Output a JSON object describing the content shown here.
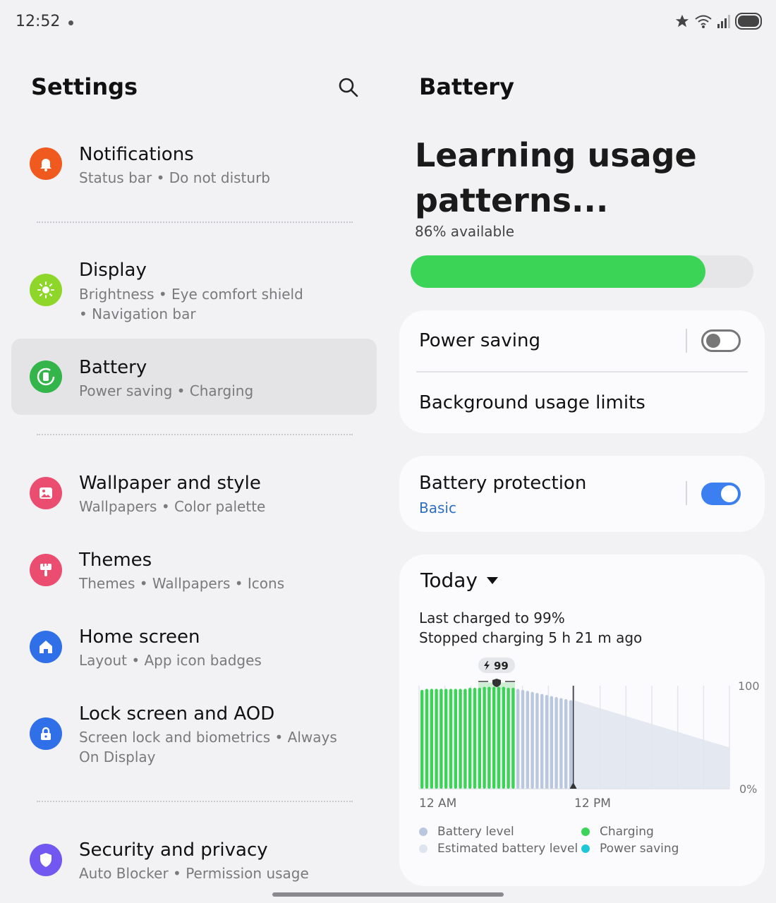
{
  "status_bar": {
    "time": "12:52",
    "icons": [
      "star-icon",
      "wifi-icon",
      "signal-icon",
      "battery-icon"
    ]
  },
  "left": {
    "title": "Settings",
    "items": [
      {
        "name": "notifications",
        "title": "Notifications",
        "subtitle": "Status bar  •  Do not disturb",
        "icon": "bell-icon",
        "color": "#f05a1f"
      },
      {
        "name": "display",
        "title": "Display",
        "subtitle": "Brightness  •  Eye comfort shield  •  Navigation bar",
        "icon": "sun-icon",
        "color": "#8fd62a"
      },
      {
        "name": "battery",
        "title": "Battery",
        "subtitle": "Power saving  •  Charging",
        "icon": "battery-circle-icon",
        "color": "#33b54a"
      },
      {
        "name": "wallpaper",
        "title": "Wallpaper and style",
        "subtitle": "Wallpapers  •  Color palette",
        "icon": "image-icon",
        "color": "#ea4d6f"
      },
      {
        "name": "themes",
        "title": "Themes",
        "subtitle": "Themes  •  Wallpapers  •  Icons",
        "icon": "brush-icon",
        "color": "#ea4d6f"
      },
      {
        "name": "home-screen",
        "title": "Home screen",
        "subtitle": "Layout  •  App icon badges",
        "icon": "home-icon",
        "color": "#2f6fe8"
      },
      {
        "name": "lock-screen",
        "title": "Lock screen and AOD",
        "subtitle": "Screen lock and biometrics  •  Always On Display",
        "icon": "lock-icon",
        "color": "#2f6fe8"
      },
      {
        "name": "security",
        "title": "Security and privacy",
        "subtitle": "Auto Blocker  •  Permission usage",
        "icon": "shield-icon",
        "color": "#7257f0"
      }
    ]
  },
  "right": {
    "title": "Battery",
    "headline": "Learning usage patterns...",
    "available": "86% available",
    "level": 0.86,
    "accent": "#3bd457",
    "power_saving": {
      "label": "Power saving",
      "on": false
    },
    "background_limits": {
      "label": "Background usage limits"
    },
    "protection": {
      "label": "Battery protection",
      "sub": "Basic",
      "on": true,
      "sub_color": "#2f6fbf"
    },
    "usage": {
      "period": "Today",
      "last_charged": "Last charged to 99%",
      "stopped": "Stopped charging 5 h 21 m ago",
      "charge_badge": "99"
    },
    "legend": [
      {
        "label": "Battery level",
        "color": "#b9c8de"
      },
      {
        "label": "Charging",
        "color": "#3bd457"
      },
      {
        "label": "Estimated battery level",
        "color": "#dfe5ef"
      },
      {
        "label": "Power saving",
        "color": "#1ec6d8"
      }
    ]
  },
  "chart_data": {
    "type": "bar",
    "title": "",
    "xlabel": "",
    "ylabel": "",
    "ylim": [
      0,
      100
    ],
    "y_ticks": [
      "100",
      "0%"
    ],
    "x_ticks": [
      "12 AM",
      "12 PM"
    ],
    "series": [
      {
        "name": "Charging",
        "values": [
          96,
          97,
          97,
          97,
          97,
          97,
          97,
          97,
          97,
          97,
          98,
          98,
          98,
          99,
          99,
          99,
          99,
          99,
          98,
          98
        ]
      },
      {
        "name": "Battery level",
        "values": [
          97,
          96,
          95,
          94,
          93,
          92,
          91,
          90,
          89,
          88,
          87,
          86
        ]
      }
    ],
    "estimated": {
      "start": 86,
      "end": 40
    },
    "grid": true
  }
}
